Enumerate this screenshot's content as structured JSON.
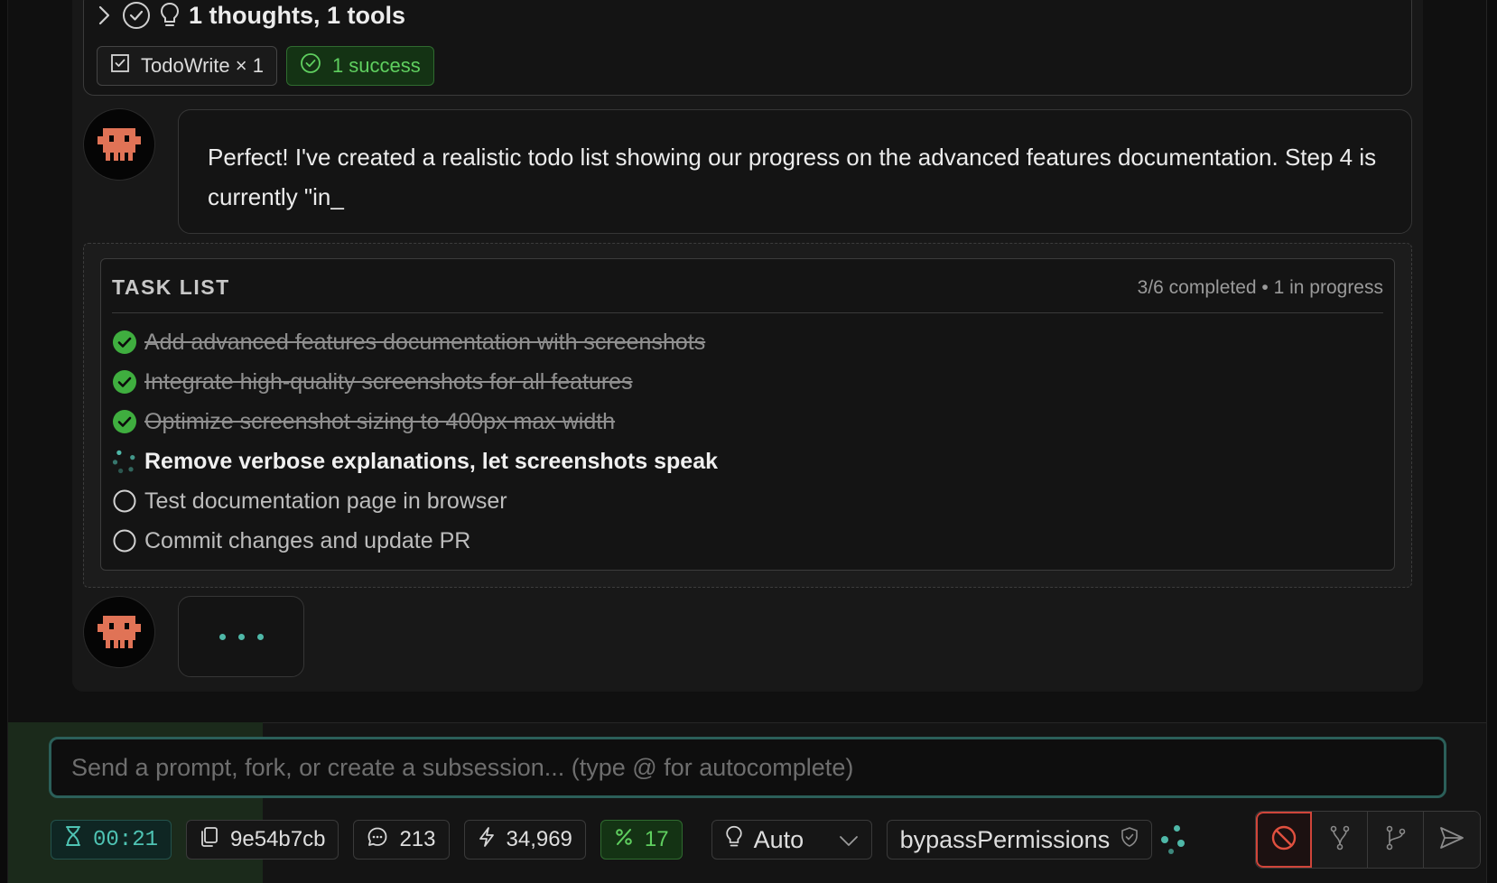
{
  "thoughts_tools": {
    "summary": "1 thoughts, 1 tools",
    "tool_chip": "TodoWrite × 1",
    "success_chip": "1 success"
  },
  "assistant_message": {
    "text": "Perfect! I've created a realistic todo list showing our progress on the advanced features documentation. Step 4 is currently \"in_"
  },
  "task_list": {
    "title": "TASK LIST",
    "summary": "3/6 completed • 1 in progress",
    "items": [
      {
        "label": "Add advanced features documentation with screenshots",
        "status": "completed"
      },
      {
        "label": "Integrate high-quality screenshots for all features",
        "status": "completed"
      },
      {
        "label": "Optimize screenshot sizing to 400px max width",
        "status": "completed"
      },
      {
        "label": "Remove verbose explanations, let screenshots speak",
        "status": "in_progress"
      },
      {
        "label": "Test documentation page in browser",
        "status": "pending"
      },
      {
        "label": "Commit changes and update PR",
        "status": "pending"
      }
    ]
  },
  "prompt": {
    "placeholder": "Send a prompt, fork, or create a subsession... (type @ for autocomplete)",
    "value": ""
  },
  "status_bar": {
    "timer": "00:21",
    "session_id": "9e54b7cb",
    "messages": "213",
    "tokens": "34,969",
    "percent": "17",
    "mode": "Auto",
    "permission_mode": "bypassPermissions"
  },
  "icons": {
    "expand": "chevron-right-icon",
    "status": "check-circle-icon",
    "thought": "lightbulb-icon",
    "tool": "checkbox-icon",
    "timer": "hourglass-icon",
    "session": "copy-icon",
    "messages": "message-icon",
    "tokens": "lightning-icon",
    "stop": "stop-icon",
    "fork": "fork-icon",
    "branch": "branch-icon",
    "send": "send-icon"
  },
  "colors": {
    "accent_teal": "#4fb8a8",
    "success_green": "#5fcf5f",
    "completed_check": "#3fae3f",
    "stop_red": "#d0453a",
    "avatar_orange": "#e07356"
  }
}
